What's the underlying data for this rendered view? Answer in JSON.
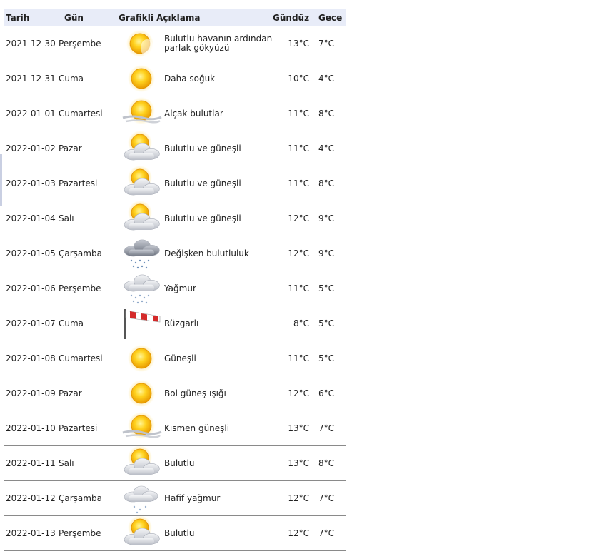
{
  "headers": {
    "date": "Tarih",
    "day": "Gün",
    "description": "Grafikli Açıklama",
    "day_temp": "Gündüz",
    "night_temp": "Gece"
  },
  "rows": [
    {
      "date": "2021-12-30",
      "day": "Perşembe",
      "icon": "sun-haze-icon",
      "desc": "Bulutlu havanın ardından parlak gökyüzü",
      "day_temp": "13°C",
      "night_temp": "7°C"
    },
    {
      "date": "2021-12-31",
      "day": "Cuma",
      "icon": "sun-icon",
      "desc": "Daha soğuk",
      "day_temp": "10°C",
      "night_temp": "4°C"
    },
    {
      "date": "2022-01-01",
      "day": "Cumartesi",
      "icon": "sun-low-clouds-icon",
      "desc": "Alçak bulutlar",
      "day_temp": "11°C",
      "night_temp": "8°C"
    },
    {
      "date": "2022-01-02",
      "day": "Pazar",
      "icon": "partly-cloudy-icon",
      "desc": "Bulutlu ve güneşli",
      "day_temp": "11°C",
      "night_temp": "4°C"
    },
    {
      "date": "2022-01-03",
      "day": "Pazartesi",
      "icon": "partly-cloudy-icon",
      "desc": "Bulutlu ve güneşli",
      "day_temp": "11°C",
      "night_temp": "8°C"
    },
    {
      "date": "2022-01-04",
      "day": "Salı",
      "icon": "partly-cloudy-icon",
      "desc": "Bulutlu ve güneşli",
      "day_temp": "12°C",
      "night_temp": "9°C"
    },
    {
      "date": "2022-01-05",
      "day": "Çarşamba",
      "icon": "storm-rain-cloud-icon",
      "desc": "Değişken bulutluluk",
      "day_temp": "12°C",
      "night_temp": "9°C"
    },
    {
      "date": "2022-01-06",
      "day": "Perşembe",
      "icon": "rain-cloud-icon",
      "desc": "Yağmur",
      "day_temp": "11°C",
      "night_temp": "5°C"
    },
    {
      "date": "2022-01-07",
      "day": "Cuma",
      "icon": "windsock-icon",
      "desc": "Rüzgarlı",
      "day_temp": "8°C",
      "night_temp": "5°C"
    },
    {
      "date": "2022-01-08",
      "day": "Cumartesi",
      "icon": "sun-icon",
      "desc": "Güneşli",
      "day_temp": "11°C",
      "night_temp": "5°C"
    },
    {
      "date": "2022-01-09",
      "day": "Pazar",
      "icon": "sun-icon",
      "desc": "Bol güneş ışığı",
      "day_temp": "12°C",
      "night_temp": "6°C"
    },
    {
      "date": "2022-01-10",
      "day": "Pazartesi",
      "icon": "sun-low-clouds-icon",
      "desc": "Kısmen güneşli",
      "day_temp": "13°C",
      "night_temp": "7°C"
    },
    {
      "date": "2022-01-11",
      "day": "Salı",
      "icon": "partly-cloudy-icon",
      "desc": "Bulutlu",
      "day_temp": "13°C",
      "night_temp": "8°C"
    },
    {
      "date": "2022-01-12",
      "day": "Çarşamba",
      "icon": "light-rain-cloud-icon",
      "desc": "Hafif yağmur",
      "day_temp": "12°C",
      "night_temp": "7°C"
    },
    {
      "date": "2022-01-13",
      "day": "Perşembe",
      "icon": "partly-cloudy-icon",
      "desc": "Bulutlu",
      "day_temp": "12°C",
      "night_temp": "7°C"
    }
  ],
  "colors": {
    "header_bg": "#e8ecf8",
    "row_border": "#8a8a8a",
    "sun_core": "#f6b800",
    "sun_edge": "#e89a00",
    "cloud": "#dadde3",
    "windsock_red": "#d42a2a"
  }
}
